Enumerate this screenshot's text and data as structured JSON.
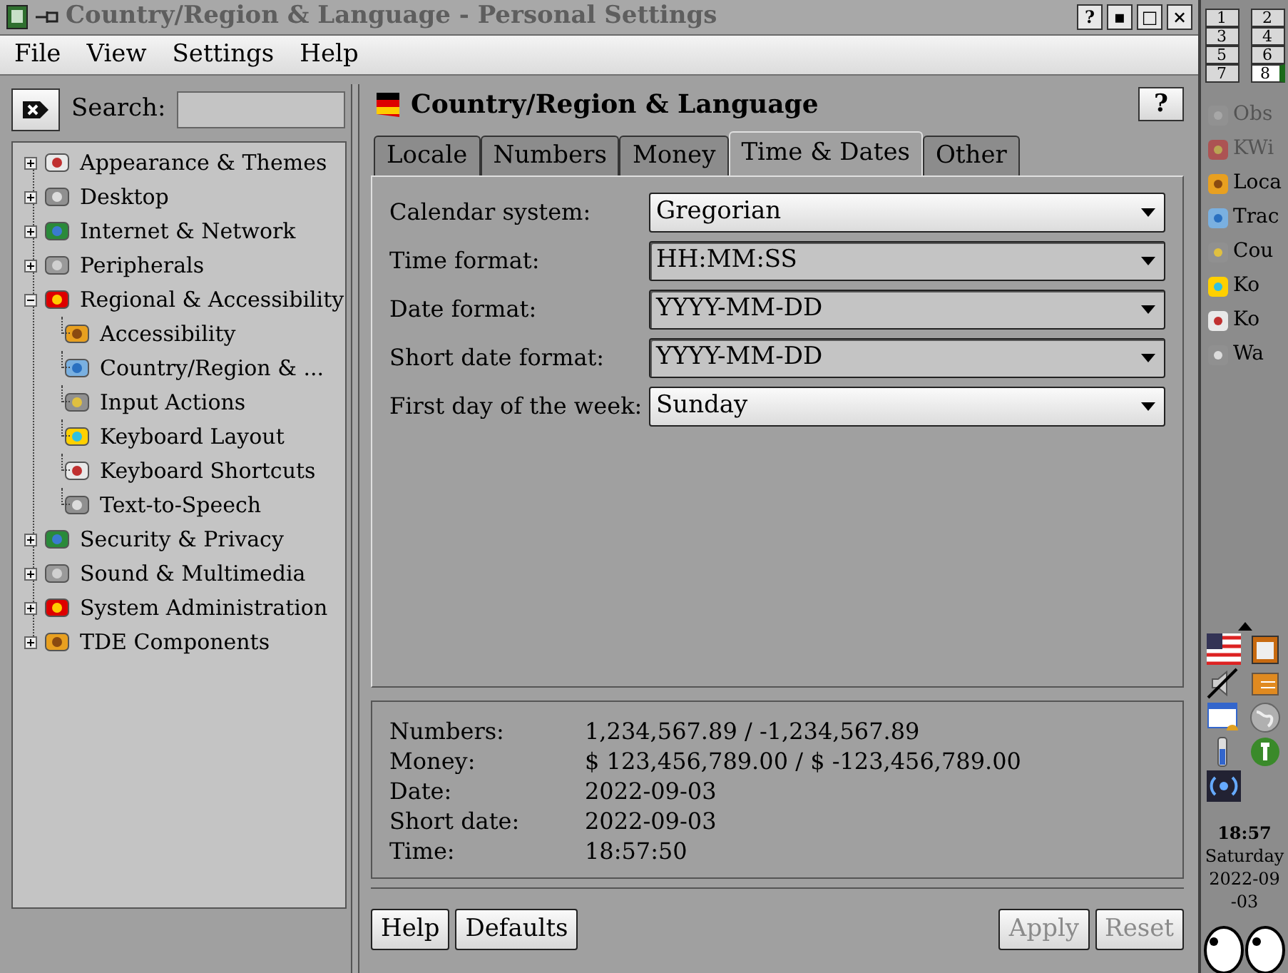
{
  "window": {
    "title": "Country/Region & Language - Personal Settings",
    "buttons": [
      "?",
      "▪",
      "□",
      "×"
    ]
  },
  "menu": [
    "File",
    "View",
    "Settings",
    "Help"
  ],
  "search": {
    "label": "Search:"
  },
  "tree": [
    {
      "label": "Appearance & Themes",
      "expanded": false,
      "selected": false
    },
    {
      "label": "Desktop",
      "expanded": false,
      "selected": false
    },
    {
      "label": "Internet & Network",
      "expanded": false,
      "selected": false
    },
    {
      "label": "Peripherals",
      "expanded": false,
      "selected": false
    },
    {
      "label": "Regional & Accessibility",
      "expanded": true,
      "selected": false,
      "children": [
        {
          "label": "Accessibility",
          "selected": false
        },
        {
          "label": "Country/Region & ...",
          "selected": false
        },
        {
          "label": "Input Actions",
          "selected": false
        },
        {
          "label": "Keyboard Layout",
          "selected": false
        },
        {
          "label": "Keyboard Shortcuts",
          "selected": false
        },
        {
          "label": "Text-to-Speech",
          "selected": false
        }
      ]
    },
    {
      "label": "Security & Privacy",
      "expanded": false,
      "selected": false
    },
    {
      "label": "Sound & Multimedia",
      "expanded": false,
      "selected": false
    },
    {
      "label": "System Administration",
      "expanded": false,
      "selected": false
    },
    {
      "label": "TDE Components",
      "expanded": false,
      "selected": false
    }
  ],
  "module": {
    "title": "Country/Region & Language",
    "help_button": "?"
  },
  "tabs": [
    {
      "label": "Locale",
      "selected": false
    },
    {
      "label": "Numbers",
      "selected": false
    },
    {
      "label": "Money",
      "selected": false
    },
    {
      "label": "Time & Dates",
      "selected": true
    },
    {
      "label": "Other",
      "selected": false
    }
  ],
  "fields": [
    {
      "label": "Calendar system:",
      "value": "Gregorian",
      "kind": "combo"
    },
    {
      "label": "Time format:",
      "value": "HH:MM:SS",
      "kind": "editable"
    },
    {
      "label": "Date format:",
      "value": "YYYY-MM-DD",
      "kind": "editable"
    },
    {
      "label": "Short date format:",
      "value": "YYYY-MM-DD",
      "kind": "editable"
    },
    {
      "label": "First day of the week:",
      "value": "Sunday",
      "kind": "combo"
    }
  ],
  "preview": [
    {
      "label": "Numbers:",
      "value": "1,234,567.89 / -1,234,567.89"
    },
    {
      "label": "Money:",
      "value": "$ 123,456,789.00 / $ -123,456,789.00"
    },
    {
      "label": "Date:",
      "value": "2022-09-03"
    },
    {
      "label": "Short date:",
      "value": "2022-09-03"
    },
    {
      "label": "Time:",
      "value": "18:57:50"
    }
  ],
  "buttons": [
    {
      "label": "Help",
      "disabled": false
    },
    {
      "label": "Defaults",
      "disabled": false
    },
    {
      "label": "Apply",
      "disabled": true
    },
    {
      "label": "Reset",
      "disabled": true
    }
  ],
  "panel": {
    "desktops": [
      {
        "label": "1",
        "selected": false
      },
      {
        "label": "2",
        "selected": false
      },
      {
        "label": "3",
        "selected": false
      },
      {
        "label": "4",
        "selected": false
      },
      {
        "label": "5",
        "selected": false
      },
      {
        "label": "6",
        "selected": false
      },
      {
        "label": "7",
        "selected": false
      },
      {
        "label": "8",
        "selected": true
      }
    ],
    "tasks": [
      {
        "label": "Obs",
        "dimmed": true
      },
      {
        "label": "KWi",
        "dimmed": true
      },
      {
        "label": "Loca",
        "dimmed": false
      },
      {
        "label": "Trac",
        "dimmed": false
      },
      {
        "label": "Cou",
        "dimmed": false
      },
      {
        "label": "Ko",
        "dimmed": false
      },
      {
        "label": "Ko",
        "dimmed": false
      },
      {
        "label": "Wa",
        "dimmed": false
      }
    ],
    "clock": {
      "time": "18:57",
      "lines": [
        "Saturday",
        "2022-09",
        "-03"
      ]
    }
  }
}
